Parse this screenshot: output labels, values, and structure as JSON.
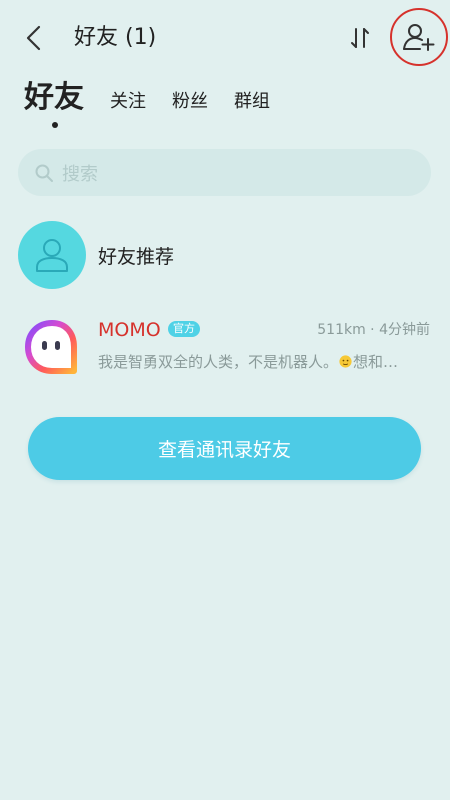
{
  "header": {
    "title": "好友 (1)",
    "back_icon": "chevron-left-icon",
    "sort_icon": "sort-icon",
    "add_friend_icon": "add-user-icon",
    "highlight_color": "#d6322c"
  },
  "tabs": [
    {
      "label": "好友",
      "active": true
    },
    {
      "label": "关注",
      "active": false
    },
    {
      "label": "粉丝",
      "active": false
    },
    {
      "label": "群组",
      "active": false
    }
  ],
  "search": {
    "placeholder": "搜索",
    "icon": "search-icon"
  },
  "recommend": {
    "label": "好友推荐",
    "icon": "user-icon",
    "color": "#55d8e0"
  },
  "friends": [
    {
      "name": "MOMO",
      "badge": "官方",
      "meta": "511km · 4分钟前",
      "bio": "我是智勇双全的人类，不是机器人。",
      "bio_tail": "想和…",
      "name_color": "#d6322c"
    }
  ],
  "contacts_button": {
    "label": "查看通讯录好友",
    "color": "#4dcbe6"
  }
}
